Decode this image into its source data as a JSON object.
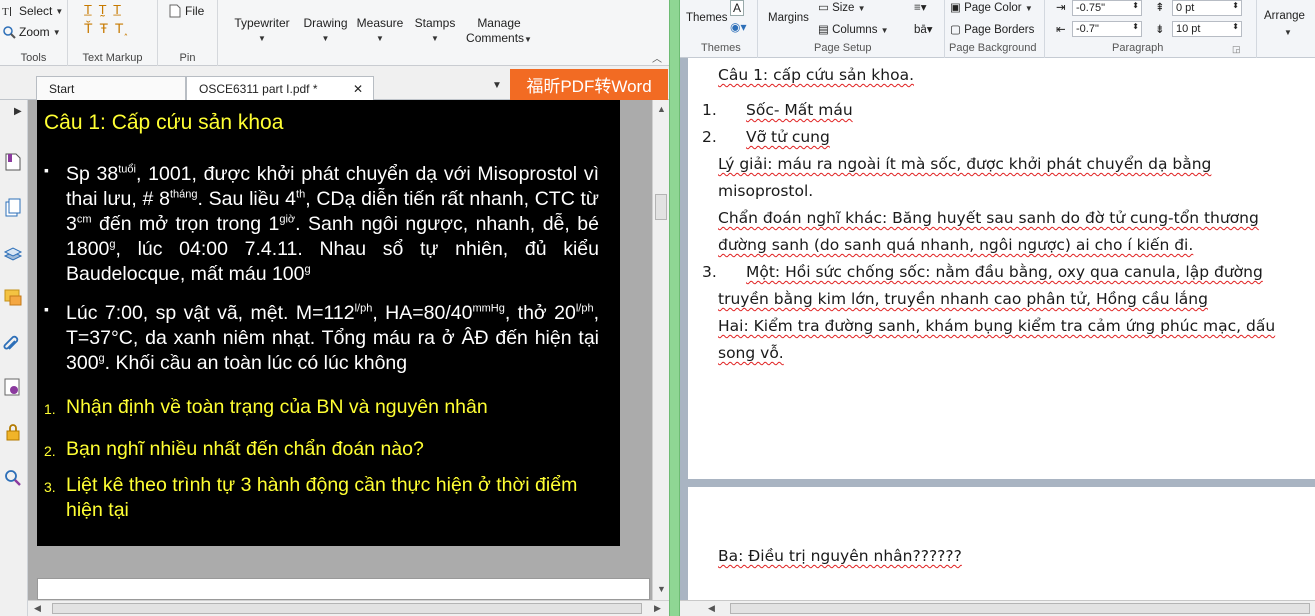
{
  "pdf": {
    "ribbon": {
      "select_label": "Select",
      "zoom_label": "Zoom",
      "tools_group": "Tools",
      "text_markup_group": "Text Markup",
      "pin_group": "Pin",
      "file_label": "File",
      "typewriter_label": "Typewriter",
      "drawing_label": "Drawing",
      "measure_label": "Measure",
      "stamps_label": "Stamps",
      "manage_label_1": "Manage",
      "manage_label_2": "Comments"
    },
    "tabs": [
      {
        "label": "Start"
      },
      {
        "label": "OSCE6311 part I.pdf *"
      }
    ],
    "brand_button": "福昕PDF转Word",
    "slide": {
      "title": "Câu 1: Cấp cứu sản khoa",
      "bullets": [
        {
          "parts": [
            "Sp 38",
            "tuổi",
            ", 1001, được khởi phát chuyển dạ với Misoprostol vì thai lưu, # 8",
            "tháng",
            ". Sau liều 4",
            "th",
            ", CDạ diễn tiến rất nhanh, CTC từ 3",
            "cm",
            " đến mở trọn trong 1",
            "giờ",
            ". Sanh ngôi ngược, nhanh, dễ, bé 1800",
            "g",
            ", lúc 04:00 7.4.11. Nhau sổ tự nhiên, đủ kiểu Baudelocque, mất máu 100",
            "g"
          ]
        },
        {
          "parts": [
            "Lúc 7:00, sp vật vã, mệt. M=112",
            "l/ph",
            ", HA=80/40",
            "mmHg",
            ", thở 20",
            "l/ph",
            ", T=37°C, da xanh niêm nhạt. Tổng máu ra ở ÂĐ đến hiện tại 300",
            "g",
            ". Khối cầu an toàn lúc có lúc không"
          ]
        }
      ],
      "questions": [
        {
          "n": "1.",
          "text": "Nhận định về toàn trạng của BN và nguyên nhân"
        },
        {
          "n": "2.",
          "text": "Bạn nghĩ nhiều nhất đến chẩn đoán nào?"
        },
        {
          "n": "3.",
          "text": "Liệt kê theo trình tự 3 hành động cần thực hiện ở thời điểm hiện tại"
        }
      ]
    },
    "colors": {
      "accent_yellow": "#ffff33",
      "brand_orange": "#f26b23",
      "divider_green": "#8fd694"
    }
  },
  "word": {
    "ribbon": {
      "themes_label": "Themes",
      "margins_label": "Margins",
      "size_label": "Size",
      "columns_label": "Columns",
      "page_color_label": "Page Color",
      "page_borders_label": "Page Borders",
      "indent_left": "-0.75\"",
      "indent_right": "-0.7\"",
      "spacing_before": "0 pt",
      "spacing_after": "10 pt",
      "arrange_label": "Arrange",
      "group_themes": "Themes",
      "group_page_setup": "Page Setup",
      "group_page_background": "Page Background",
      "group_paragraph": "Paragraph"
    },
    "page1_lines": [
      "Câu 1: cấp cứu sản khoa.",
      "Sốc- Mất máu",
      "Vỡ tử cung",
      "Lý giải: máu ra ngoài ít mà sốc, được khởi phát chuyển dạ bằng",
      "misoprostol.",
      "Chẩn đoán nghĩ khác: Băng huyết sau sanh do đờ tử cung-tổn thương",
      "đường sanh (do sanh quá nhanh, ngôi ngược) ai cho í kiến đi.",
      "Một: Hồi sức chống sốc: nằm đầu bằng, oxy qua canula, lập đường",
      "truyền bằng kim lớn, truyền nhanh cao phân tử, Hồng cầu lắng",
      "Hai: Kiểm tra đường sanh, khám bụng kiểm tra cảm ứng phúc mạc, dấu",
      "song vỗ."
    ],
    "page1_numbers": [
      "1.",
      "2.",
      "3."
    ],
    "page2_line": "Ba: Điều trị nguyên nhân??????"
  }
}
